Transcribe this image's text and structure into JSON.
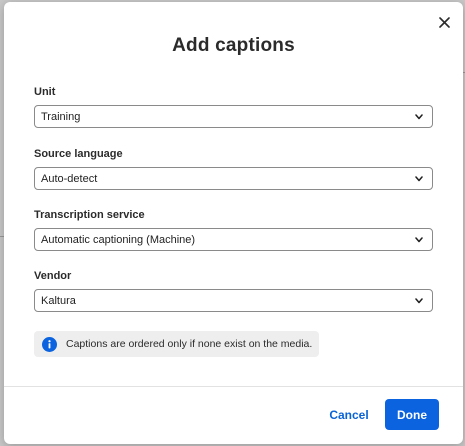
{
  "dialog": {
    "title": "Add captions",
    "close_icon": "close-icon"
  },
  "fields": {
    "unit": {
      "label": "Unit",
      "value": "Training"
    },
    "source_language": {
      "label": "Source language",
      "value": "Auto-detect"
    },
    "transcription_service": {
      "label": "Transcription service",
      "value": "Automatic captioning (Machine)"
    },
    "vendor": {
      "label": "Vendor",
      "value": "Kaltura"
    }
  },
  "info": {
    "icon": "info-icon",
    "text": "Captions are ordered only if none exist on the media.",
    "color": "#0b63e0"
  },
  "footer": {
    "cancel_label": "Cancel",
    "done_label": "Done"
  },
  "colors": {
    "accent": "#0b63e0",
    "backdrop": "#c9c9c9"
  }
}
